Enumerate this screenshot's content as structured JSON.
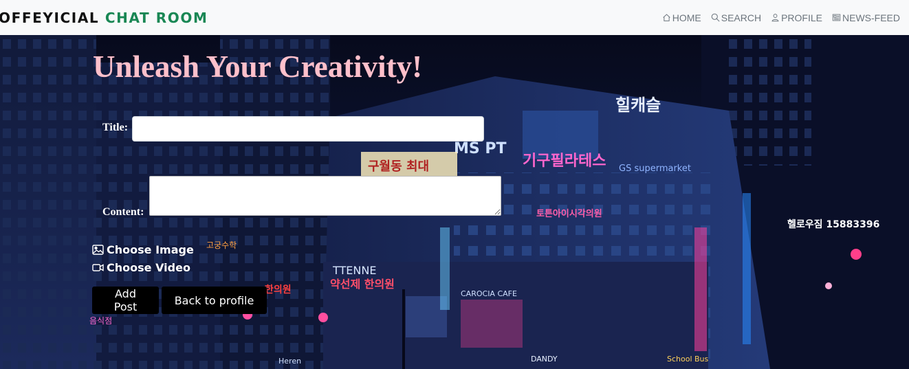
{
  "navbar": {
    "brand_primary": "OFFEYICIAL",
    "brand_accent": "CHAT ROOM",
    "links": [
      {
        "label": "HOME",
        "icon": "house-icon"
      },
      {
        "label": "SEARCH",
        "icon": "search-icon"
      },
      {
        "label": "PROFILE",
        "icon": "person-icon"
      },
      {
        "label": "NEWS-FEED",
        "icon": "newspaper-icon"
      }
    ]
  },
  "form": {
    "heading": "Unleash Your Creativity!",
    "title_label": "Title:",
    "title_value": "",
    "content_label": "Content:",
    "content_value": "",
    "choose_image_label": "Choose Image",
    "choose_video_label": "Choose Video",
    "add_post_label": "Add Post",
    "back_label": "Back to profile"
  },
  "colors": {
    "brand_accent": "#198754",
    "heading": "#ffc0cb",
    "navbar_bg": "#f8f9fa",
    "button_bg": "#000000"
  }
}
